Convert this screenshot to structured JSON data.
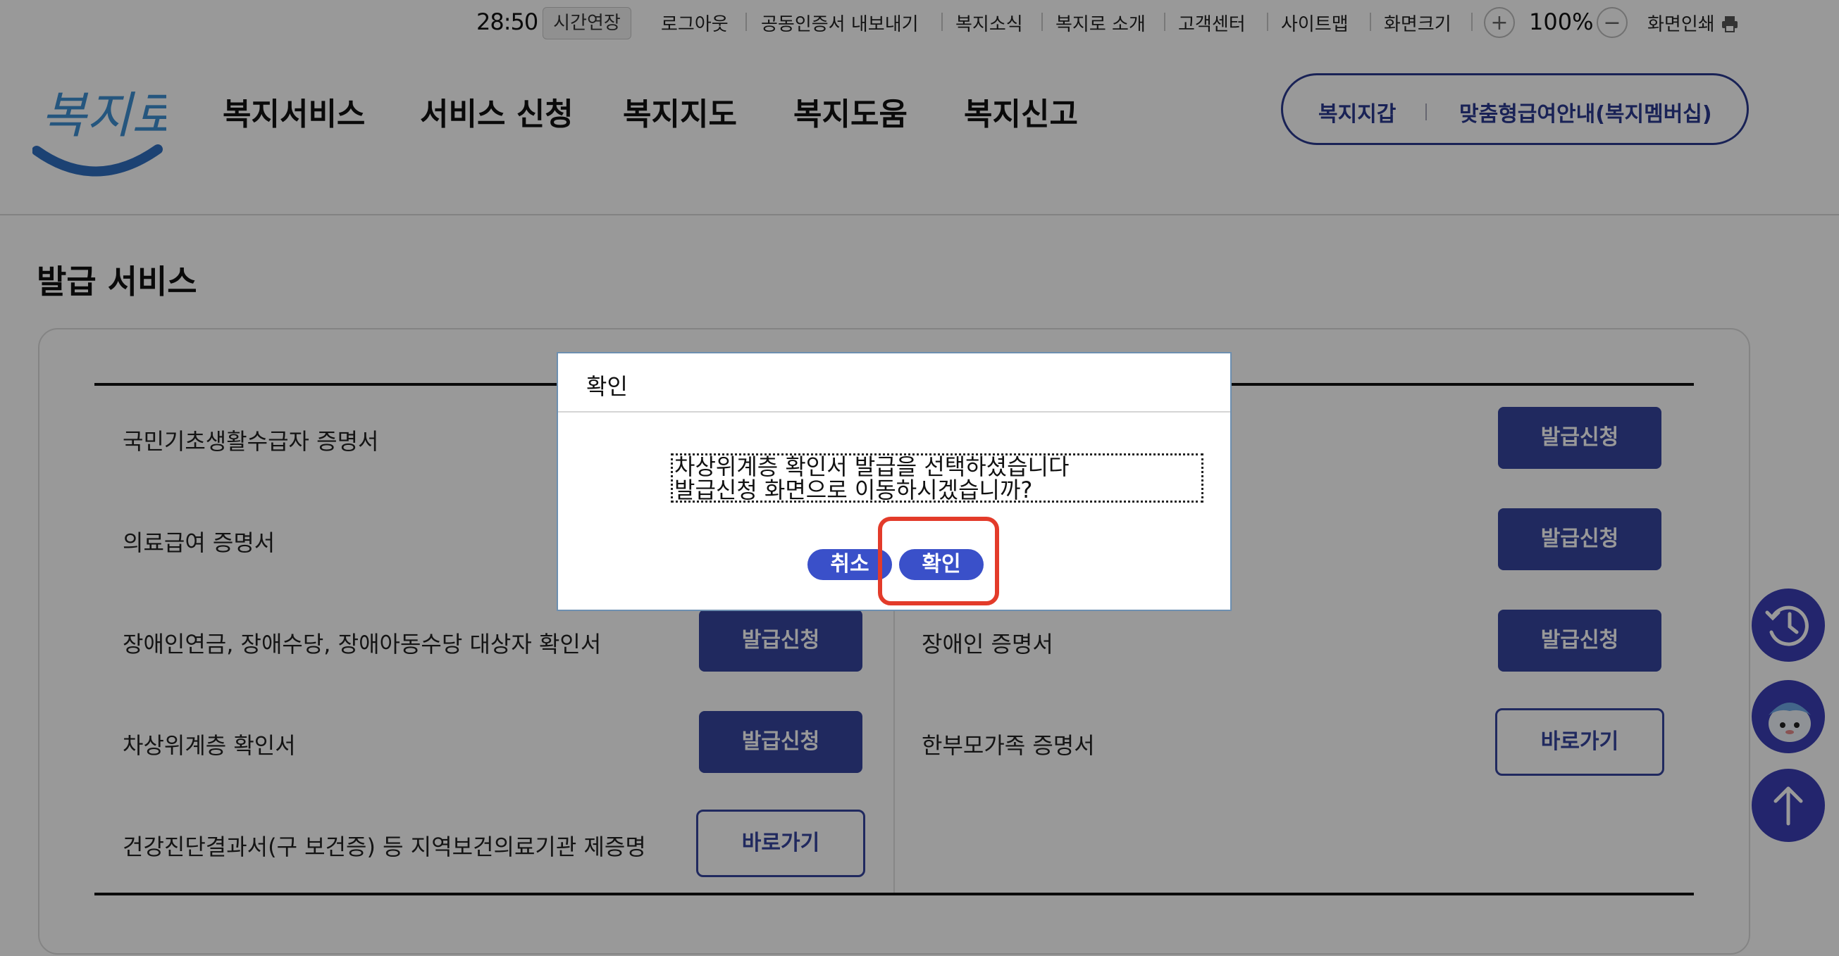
{
  "topbar": {
    "timer": "28:50",
    "extend_label": "시간연장",
    "links": [
      "로그아웃",
      "공동인증서 내보내기",
      "복지소식",
      "복지로 소개",
      "고객센터",
      "사이트맵",
      "화면크기"
    ],
    "zoom_in": "+",
    "zoom_value": "100%",
    "zoom_out": "−",
    "print_label": "화면인쇄"
  },
  "header": {
    "logo_text": "복지로",
    "nav": [
      "복지서비스",
      "서비스 신청",
      "복지지도",
      "복지도움",
      "복지신고"
    ],
    "wallet_label": "복지지갑",
    "membership_label": "맞춤형급여안내(복지멤버십)"
  },
  "main": {
    "section_title": "발급 서비스",
    "left_items": [
      {
        "label": "국민기초생활수급자 증명서",
        "button": ""
      },
      {
        "label": "의료급여 증명서",
        "button": ""
      },
      {
        "label": "장애인연금, 장애수당, 장애아동수당 대상자 확인서",
        "button": "발급신청"
      },
      {
        "label": "차상위계층 확인서",
        "button": "발급신청"
      },
      {
        "label": "건강진단결과서(구 보건증) 등 지역보건의료기관 제증명",
        "button": "바로가기"
      }
    ],
    "right_items": [
      {
        "label": "",
        "button": "발급신청"
      },
      {
        "label": "",
        "button": "발급신청"
      },
      {
        "label": "장애인 증명서",
        "button": "발급신청"
      },
      {
        "label": "한부모가족 증명서",
        "button": "바로가기"
      }
    ]
  },
  "dialog": {
    "title": "확인",
    "message_line1": "차상위계층 확인서 발급을 선택하셨습니다",
    "message_line2": "발급신청 화면으로 이동하시겠습니까?",
    "cancel_label": "취소",
    "confirm_label": "확인"
  },
  "colors": {
    "brand": "#36459f",
    "dialog_button": "#3a50c9",
    "highlight": "#e33b2a"
  },
  "side_buttons": [
    "history-icon",
    "chatbot-icon",
    "scroll-top-icon"
  ]
}
